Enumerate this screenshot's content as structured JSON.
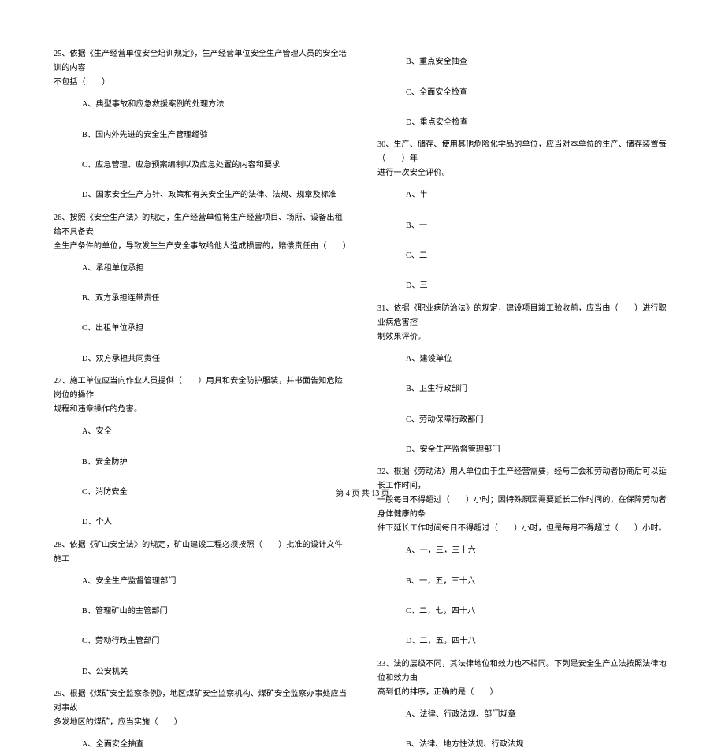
{
  "footer": "第 4 页 共 13 页",
  "leftCol": {
    "q25": {
      "stem": "25、依据《生产经营单位安全培训规定》，生产经营单位安全生产管理人员的安全培训的内容",
      "stem2": "不包括（　　）",
      "optA": "A、典型事故和应急救援案例的处理方法",
      "optB": "B、国内外先进的安全生产管理经验",
      "optC": "C、应急管理、应急预案编制以及应急处置的内容和要求",
      "optD": "D、国家安全生产方针、政策和有关安全生产的法律、法规、规章及标准"
    },
    "q26": {
      "stem": "26、按照《安全生产法》的规定，生产经营单位将生产经营项目、场所、设备出租给不具备安",
      "stem2": "全生产条件的单位，导致发生生产安全事故给他人造成损害的，赔偿责任由（　　）",
      "optA": "A、承租单位承担",
      "optB": "B、双方承担连带责任",
      "optC": "C、出租单位承担",
      "optD": "D、双方承担共同责任"
    },
    "q27": {
      "stem": "27、施工单位应当向作业人员提供（　　）用具和安全防护服装，并书面告知危险岗位的操作",
      "stem2": "规程和违章操作的危害。",
      "optA": "A、安全",
      "optB": "B、安全防护",
      "optC": "C、消防安全",
      "optD": "D、个人"
    },
    "q28": {
      "stem": "28、依据《矿山安全法》的规定，矿山建设工程必须按照（　　）批准的设计文件施工",
      "optA": "A、安全生产监督管理部门",
      "optB": "B、管理矿山的主管部门",
      "optC": "C、劳动行政主管部门",
      "optD": "D、公安机关"
    },
    "q29": {
      "stem": "29、根据《煤矿安全监察条例》，地区煤矿安全监察机构、煤矿安全监察办事处应当对事故",
      "stem2": "多发地区的煤矿，应当实施（　　）",
      "optA": "A、全面安全抽查"
    }
  },
  "rightCol": {
    "q29tail": {
      "optB": "B、重点安全抽查",
      "optC": "C、全面安全检查",
      "optD": "D、重点安全检查"
    },
    "q30": {
      "stem": "30、生产、储存、使用其他危险化学品的单位，应当对本单位的生产、储存装置每（　　）年",
      "stem2": "进行一次安全评价。",
      "optA": "A、半",
      "optB": "B、一",
      "optC": "C、二",
      "optD": "D、三"
    },
    "q31": {
      "stem": "31、依据《职业病防治法》的规定，建设项目竣工验收前，应当由（　　）进行职业病危害控",
      "stem2": "制效果评价。",
      "optA": "A、建设单位",
      "optB": "B、卫生行政部门",
      "optC": "C、劳动保障行政部门",
      "optD": "D、安全生产监督管理部门"
    },
    "q32": {
      "stem": "32、根据《劳动法》用人单位由于生产经营需要，经与工会和劳动者协商后可以延长工作时间，",
      "stem2": "一般每日不得超过（　　）小时；因特殊原因需要延长工作时间的，在保障劳动者身体健康的条",
      "stem3": "件下延长工作时间每日不得超过（　　）小时，但是每月不得超过（　　）小时。",
      "optA": "A、一，三，三十六",
      "optB": "B、一，五，三十六",
      "optC": "C、二，七，四十八",
      "optD": "D、二，五，四十八"
    },
    "q33": {
      "stem": "33、法的层级不同，其法律地位和效力也不相同。下列是安全生产立法按照法律地位和效力由",
      "stem2": "高到低的排序，正确的是（　　）",
      "optA": "A、法律、行政法规、部门规章",
      "optB": "B、法律、地方性法规、行政法规"
    }
  }
}
